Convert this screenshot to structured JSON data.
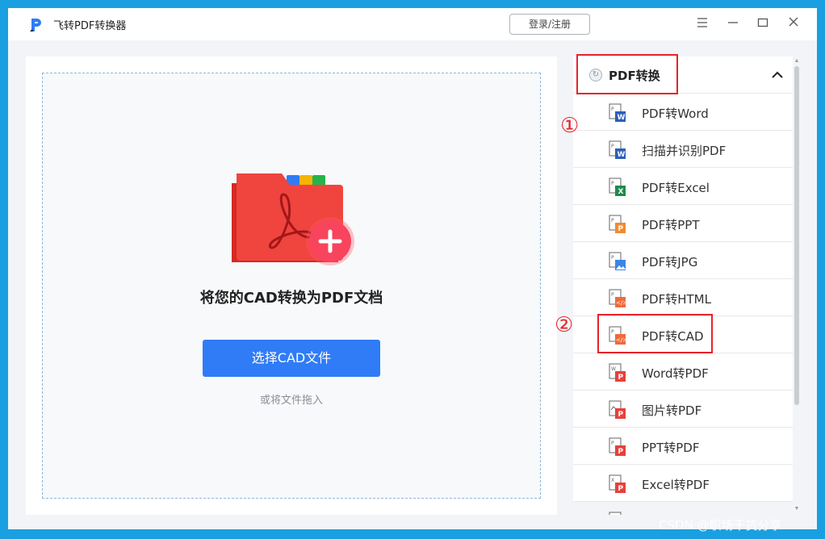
{
  "app": {
    "title": "飞转PDF转换器",
    "login_label": "登录/注册",
    "controls": [
      "menu-icon",
      "minimize-icon",
      "maximize-icon",
      "close-icon"
    ]
  },
  "main": {
    "drop_title": "将您的CAD转换为PDF文档",
    "select_button": "选择CAD文件",
    "drag_hint": "或将文件拖入"
  },
  "sidebar": {
    "section_title": "PDF转换",
    "items": [
      {
        "label": "PDF转Word",
        "icon": "word-icon",
        "color": "#2b5fb8"
      },
      {
        "label": "扫描并识别PDF",
        "icon": "word-icon",
        "color": "#2b5fb8"
      },
      {
        "label": "PDF转Excel",
        "icon": "excel-icon",
        "color": "#1f8a4c"
      },
      {
        "label": "PDF转PPT",
        "icon": "ppt-icon",
        "color": "#f28a2e"
      },
      {
        "label": "PDF转JPG",
        "icon": "image-icon",
        "color": "#3a86e8"
      },
      {
        "label": "PDF转HTML",
        "icon": "html-icon",
        "color": "#f06a3a"
      },
      {
        "label": "PDF转CAD",
        "icon": "cad-icon",
        "color": "#f06a3a"
      },
      {
        "label": "Word转PDF",
        "icon": "pdf-icon",
        "color": "#e8403a"
      },
      {
        "label": "图片转PDF",
        "icon": "pdf-icon",
        "color": "#e8403a"
      },
      {
        "label": "PPT转PDF",
        "icon": "pdf-icon",
        "color": "#e8403a"
      },
      {
        "label": "Excel转PDF",
        "icon": "pdf-icon",
        "color": "#e8403a"
      }
    ]
  },
  "annotations": {
    "step1": "①",
    "step2": "②"
  },
  "watermark": "CSDN @职场干货分享",
  "colors": {
    "accent": "#2f7cf6",
    "annotation": "#e8232a",
    "frame": "#1aa0e0"
  }
}
